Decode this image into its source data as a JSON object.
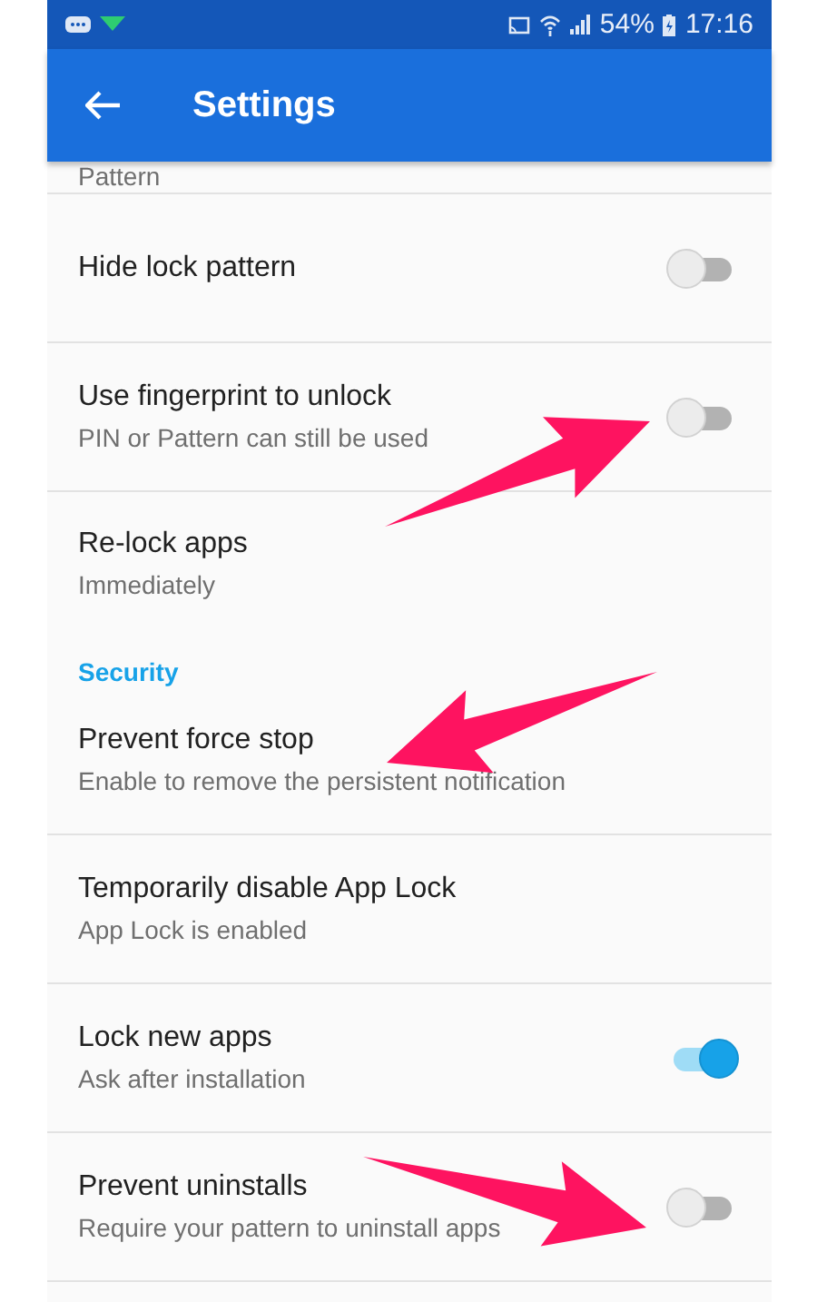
{
  "status_bar": {
    "battery": "54%",
    "time": "17:16"
  },
  "app_bar": {
    "title": "Settings"
  },
  "partial_item": {
    "subtitle": "Pattern"
  },
  "items": [
    {
      "kind": "toggle",
      "title": "Hide lock pattern",
      "on": false
    },
    {
      "kind": "toggle",
      "title": "Use fingerprint to unlock",
      "subtitle": "PIN or Pattern can still be used",
      "on": false
    },
    {
      "kind": "text",
      "title": "Re-lock apps",
      "subtitle": "Immediately"
    },
    {
      "kind": "header",
      "title": "Security"
    },
    {
      "kind": "text",
      "title": "Prevent force stop",
      "subtitle": "Enable to remove the persistent notification"
    },
    {
      "kind": "text",
      "title": "Temporarily disable App Lock",
      "subtitle": "App Lock is enabled"
    },
    {
      "kind": "toggle",
      "title": "Lock new apps",
      "subtitle": "Ask after installation",
      "on": true
    },
    {
      "kind": "toggle",
      "title": "Prevent uninstalls",
      "subtitle": "Require your pattern to uninstall apps",
      "on": false
    }
  ]
}
